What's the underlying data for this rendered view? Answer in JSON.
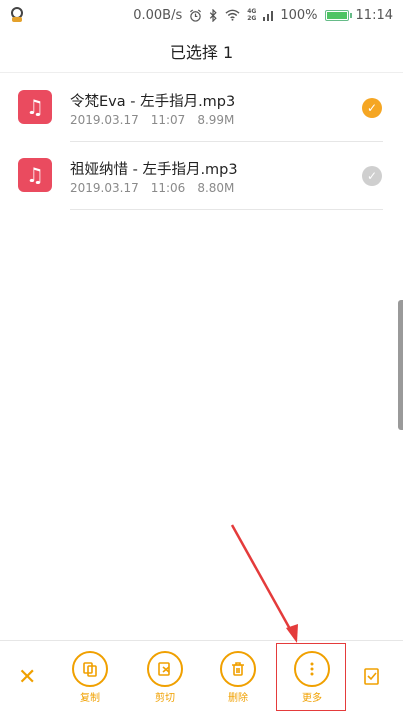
{
  "status_bar": {
    "network_speed": "0.00B/s",
    "net_tag_top": "4G",
    "net_tag_bottom": "2G",
    "battery": "100%",
    "time": "11:14",
    "icons": [
      "qq-icon",
      "alarm-icon",
      "bluetooth-icon",
      "wifi-icon",
      "signal-icon",
      "battery-icon"
    ]
  },
  "header": {
    "title": "已选择 1"
  },
  "files": [
    {
      "name": "令梵Eva - 左手指月.mp3",
      "date": "2019.03.17",
      "time": "11:07",
      "size": "8.99M",
      "selected": true
    },
    {
      "name": "祖娅纳惜 - 左手指月.mp3",
      "date": "2019.03.17",
      "time": "11:06",
      "size": "8.80M",
      "selected": false
    }
  ],
  "toolbar": {
    "close_icon": "✕",
    "copy_label": "复制",
    "cut_label": "剪切",
    "delete_label": "删除",
    "more_label": "更多"
  },
  "colors": {
    "accent": "#f0a000",
    "file_icon": "#ea4b5f",
    "annotation": "#e43b3b"
  }
}
